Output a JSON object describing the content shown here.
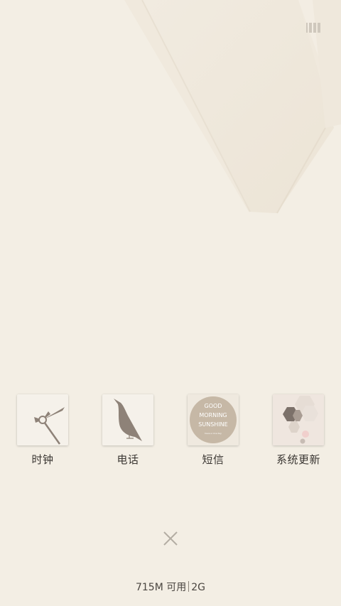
{
  "status": {
    "icon": "recent-apps-icon"
  },
  "colors": {
    "background": "#f3eee4",
    "icon_brown": "#8e8278",
    "label_text": "#3a3632"
  },
  "apps": [
    {
      "label": "时钟",
      "icon": "clock-icon"
    },
    {
      "label": "电话",
      "icon": "bird-icon"
    },
    {
      "label": "短信",
      "icon": "good-morning-sunshine-icon",
      "icon_text": [
        "GOOD",
        "MORNING",
        "SUNSHINE"
      ],
      "icon_subtext": "have a nice day"
    },
    {
      "label": "系统更新",
      "icon": "hexagons-icon"
    }
  ],
  "close": {
    "icon": "close-icon"
  },
  "memory": {
    "available": "715M 可用",
    "total": "2G"
  }
}
